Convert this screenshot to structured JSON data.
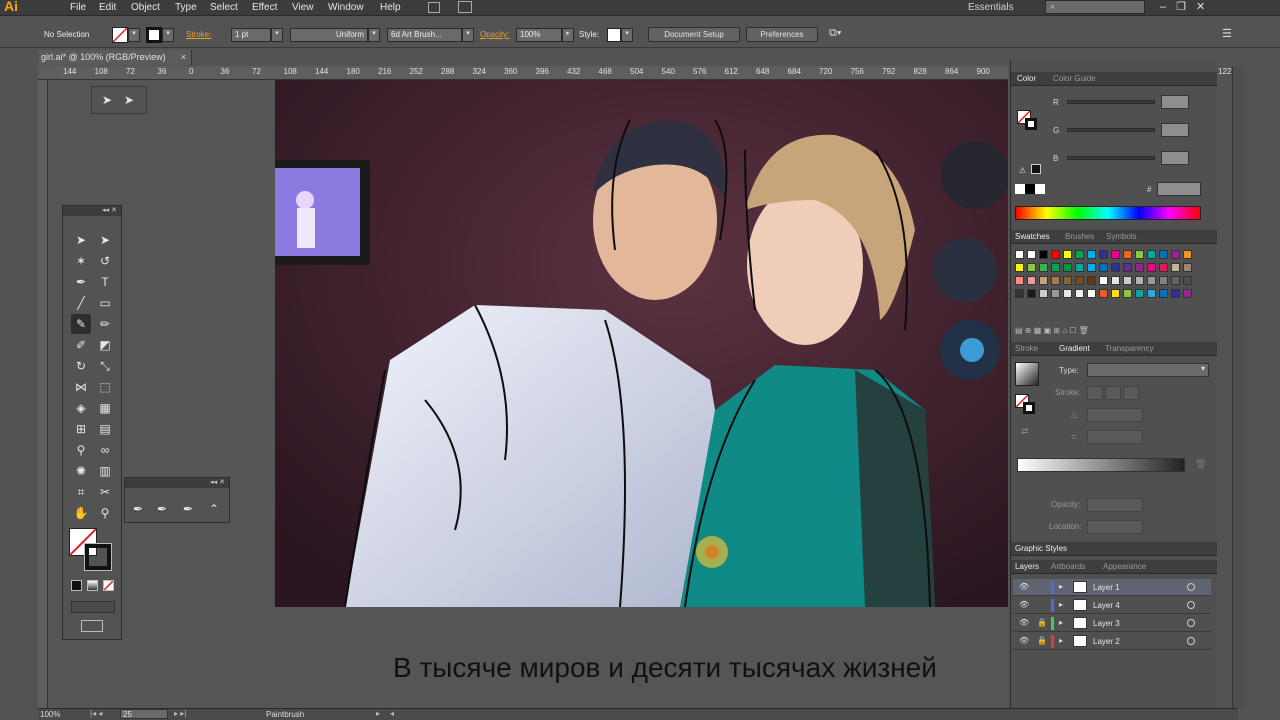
{
  "app": {
    "logo": "Ai"
  },
  "menu": [
    "File",
    "Edit",
    "Object",
    "Type",
    "Select",
    "Effect",
    "View",
    "Window",
    "Help"
  ],
  "workspace": "Essentials",
  "control": {
    "selection": "No Selection",
    "stroke_label": "Stroke:",
    "stroke_value": "1 pt",
    "profile": "Uniform",
    "brush": "6d Art Brush...",
    "opacity_label": "Opacity:",
    "opacity_value": "100%",
    "style_label": "Style:",
    "doc_setup": "Document Setup",
    "preferences": "Preferences"
  },
  "document": {
    "tab_title": "girl.ai* @ 100% (RGB/Preview)",
    "close": "×"
  },
  "ruler": [
    "144",
    "108",
    "72",
    "36",
    "0",
    "36",
    "72",
    "108",
    "144",
    "180",
    "216",
    "252",
    "288",
    "324",
    "360",
    "396",
    "432",
    "468",
    "504",
    "540",
    "576",
    "612",
    "648",
    "684",
    "720",
    "756",
    "792",
    "828",
    "864",
    "900",
    "936"
  ],
  "ruler_end": "122",
  "subtitle": "В тысяче миров и десяти тысячах жизней",
  "color_panel": {
    "tabs": [
      "Color",
      "Color Guide"
    ],
    "channels": [
      "R",
      "G",
      "B"
    ],
    "hex_label": "#"
  },
  "swatches_panel": {
    "tabs": [
      "Swatches",
      "Brushes",
      "Symbols"
    ]
  },
  "gradient_panel": {
    "tabs": [
      "Stroke",
      "Gradient",
      "Transparency"
    ],
    "type_label": "Type:",
    "stroke_label": "Stroke:",
    "opacity_label": "Opacity:",
    "location_label": "Location:"
  },
  "graphic_styles": {
    "title": "Graphic Styles"
  },
  "layers_panel": {
    "tabs": [
      "Layers",
      "Artboards",
      "Appearance"
    ],
    "layers": [
      {
        "name": "Layer 1",
        "color": "#4a6bd8",
        "locked": false
      },
      {
        "name": "Layer 4",
        "color": "#4a6bd8",
        "locked": false
      },
      {
        "name": "Layer 3",
        "color": "#3fcf52",
        "locked": true
      },
      {
        "name": "Layer 2",
        "color": "#e03a3a",
        "locked": true
      }
    ]
  },
  "status": {
    "zoom": "100%",
    "page": "25",
    "tool": "Paintbrush"
  }
}
